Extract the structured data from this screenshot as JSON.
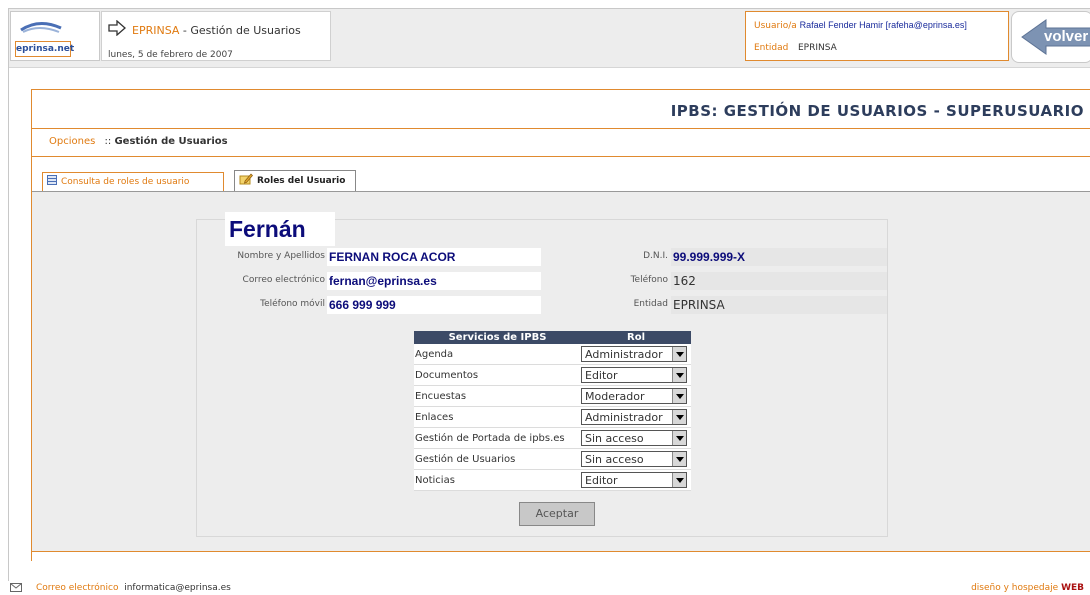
{
  "header": {
    "logo_text": "eprinsa.net",
    "app_title": "EPRINSA",
    "app_subtitle": "- Gestión de Usuarios",
    "date": "lunes, 5 de febrero de 2007",
    "user_label": "Usuario/a",
    "user_value": "Rafael Fender Hamir [rafeha@eprinsa.es]",
    "entity_label": "Entidad",
    "entity_value": "EPRINSA",
    "back_label": "volver"
  },
  "page": {
    "title": "IPBS: GESTIÓN DE USUARIOS - SUPERUSUARIO",
    "breadcrumb_options": "Opciones",
    "breadcrumb_sep": "::",
    "breadcrumb_current": "Gestión de Usuarios"
  },
  "tabs": [
    {
      "label": "Consulta de roles de usuario",
      "icon": "table-icon",
      "active": false
    },
    {
      "label": "Roles del Usuario",
      "icon": "pencil-icon",
      "active": true
    }
  ],
  "user": {
    "display_name": "Fernán",
    "fields_left": [
      {
        "label": "Nombre y Apellidos",
        "value": "FERNAN ROCA ACOR"
      },
      {
        "label": "Correo electrónico",
        "value": "fernan@eprinsa.es"
      },
      {
        "label": "Teléfono móvil",
        "value": "666 999 999"
      }
    ],
    "fields_right": [
      {
        "label": "D.N.I.",
        "value": "99.999.999-X"
      },
      {
        "label": "Teléfono",
        "value": "162"
      },
      {
        "label": "Entidad",
        "value": "EPRINSA"
      }
    ]
  },
  "services": {
    "col_service": "Servicios de IPBS",
    "col_role": "Rol",
    "rows": [
      {
        "service": "Agenda",
        "role": "Administrador"
      },
      {
        "service": "Documentos",
        "role": "Editor"
      },
      {
        "service": "Encuestas",
        "role": "Moderador"
      },
      {
        "service": "Enlaces",
        "role": "Administrador"
      },
      {
        "service": "Gestión de Portada de ipbs.es",
        "role": "Sin acceso"
      },
      {
        "service": "Gestión de Usuarios",
        "role": "Sin acceso"
      },
      {
        "service": "Noticias",
        "role": "Editor"
      }
    ]
  },
  "accept_label": "Aceptar",
  "footer": {
    "email_label": "Correo electrónico",
    "email_value": "informatica@eprinsa.es",
    "design_label": "diseño y hospedaje",
    "design_logo": "WEB"
  },
  "colors": {
    "accent_orange": "#e07a10",
    "navy": "#0c0c7a",
    "table_header": "#3c4a66"
  }
}
